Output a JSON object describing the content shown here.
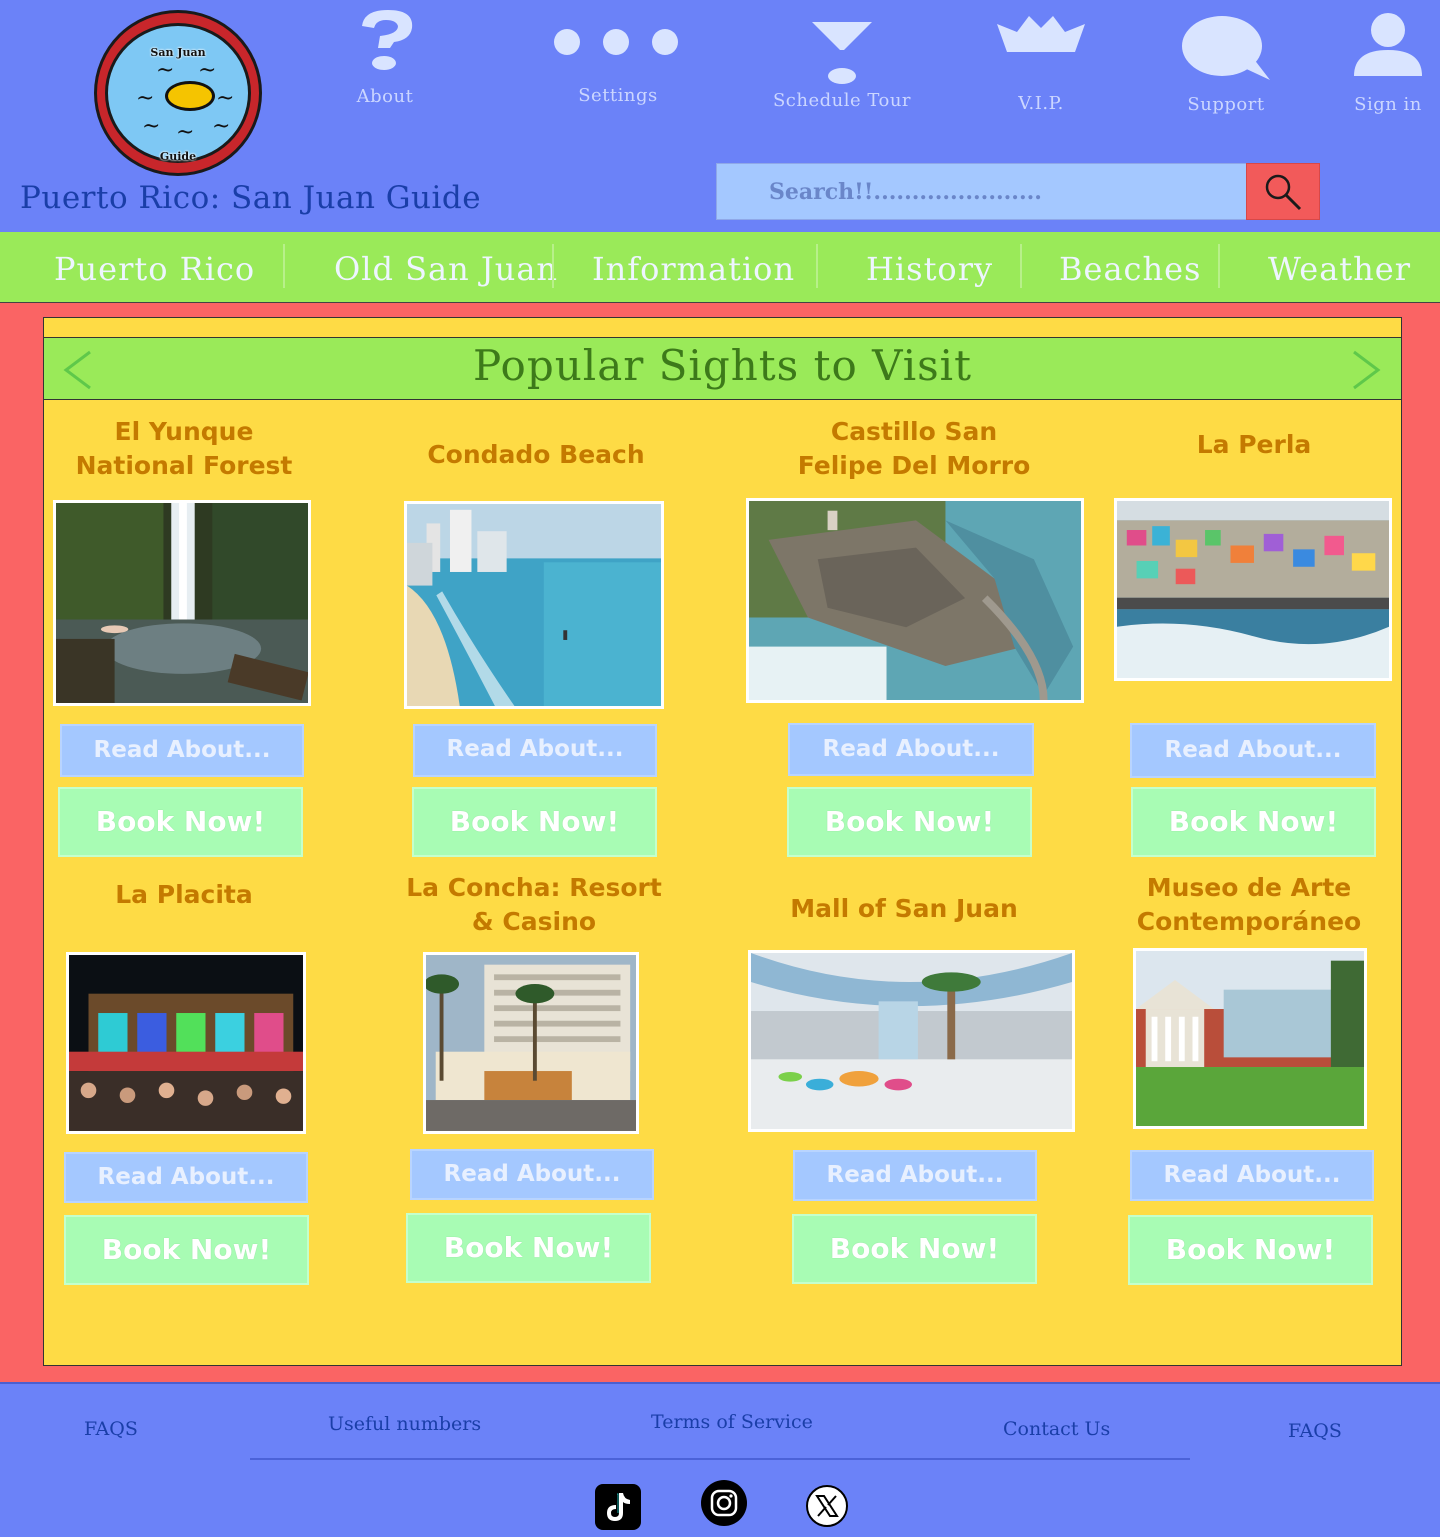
{
  "header": {
    "logo_top_text": "San Juan",
    "logo_bottom_text": "Guide",
    "site_title": "Puerto Rico: San Juan Guide",
    "icon_nav": [
      {
        "label": "About",
        "icon": "question-mark-icon"
      },
      {
        "label": "Settings",
        "icon": "more-dots-icon"
      },
      {
        "label": "Schedule Tour",
        "icon": "funnel-icon"
      },
      {
        "label": "V.I.P.",
        "icon": "crown-icon"
      },
      {
        "label": "Support",
        "icon": "speech-bubble-icon"
      },
      {
        "label": "Sign in",
        "icon": "user-icon"
      }
    ],
    "search": {
      "placeholder": "Search!!......................",
      "button_icon": "search-icon"
    }
  },
  "main_nav": [
    "Puerto Rico",
    "Old San Juan",
    "Information",
    "History",
    "Beaches",
    "Weather"
  ],
  "carousel": {
    "title": "Popular Sights to Visit",
    "prev_icon": "chevron-left-icon",
    "next_icon": "chevron-right-icon"
  },
  "sights": [
    {
      "title": "El Yunque\nNational Forest",
      "read": "Read About...",
      "book": "Book Now!"
    },
    {
      "title": "Condado Beach",
      "read": "Read About...",
      "book": "Book Now!"
    },
    {
      "title": "Castillo San\nFelipe Del Morro",
      "read": "Read About...",
      "book": "Book Now!"
    },
    {
      "title": "La Perla",
      "read": "Read About...",
      "book": "Book Now!"
    },
    {
      "title": "La Placita",
      "read": "Read About...",
      "book": "Book Now!"
    },
    {
      "title": "La Concha: Resort\n& Casino",
      "read": "Read About...",
      "book": "Book Now!"
    },
    {
      "title": "Mall of San Juan",
      "read": "Read About...",
      "book": "Book Now!"
    },
    {
      "title": "Museo de Arte\nContemporáneo",
      "read": "Read About...",
      "book": "Book Now!"
    }
  ],
  "footer": {
    "links": [
      "FAQS",
      "Useful numbers",
      "Terms of Service",
      "Contact Us",
      "FAQS"
    ],
    "social": [
      "tiktok-icon",
      "instagram-icon",
      "x-icon"
    ]
  },
  "colors": {
    "header_bg": "#6b82f8",
    "nav_bg": "#9aea59",
    "content_bg": "#fa6464",
    "panel_bg": "#fedb45",
    "read_btn": "#a4c8ff",
    "book_btn": "#a8fcb4",
    "search_btn": "#f25a5a"
  }
}
